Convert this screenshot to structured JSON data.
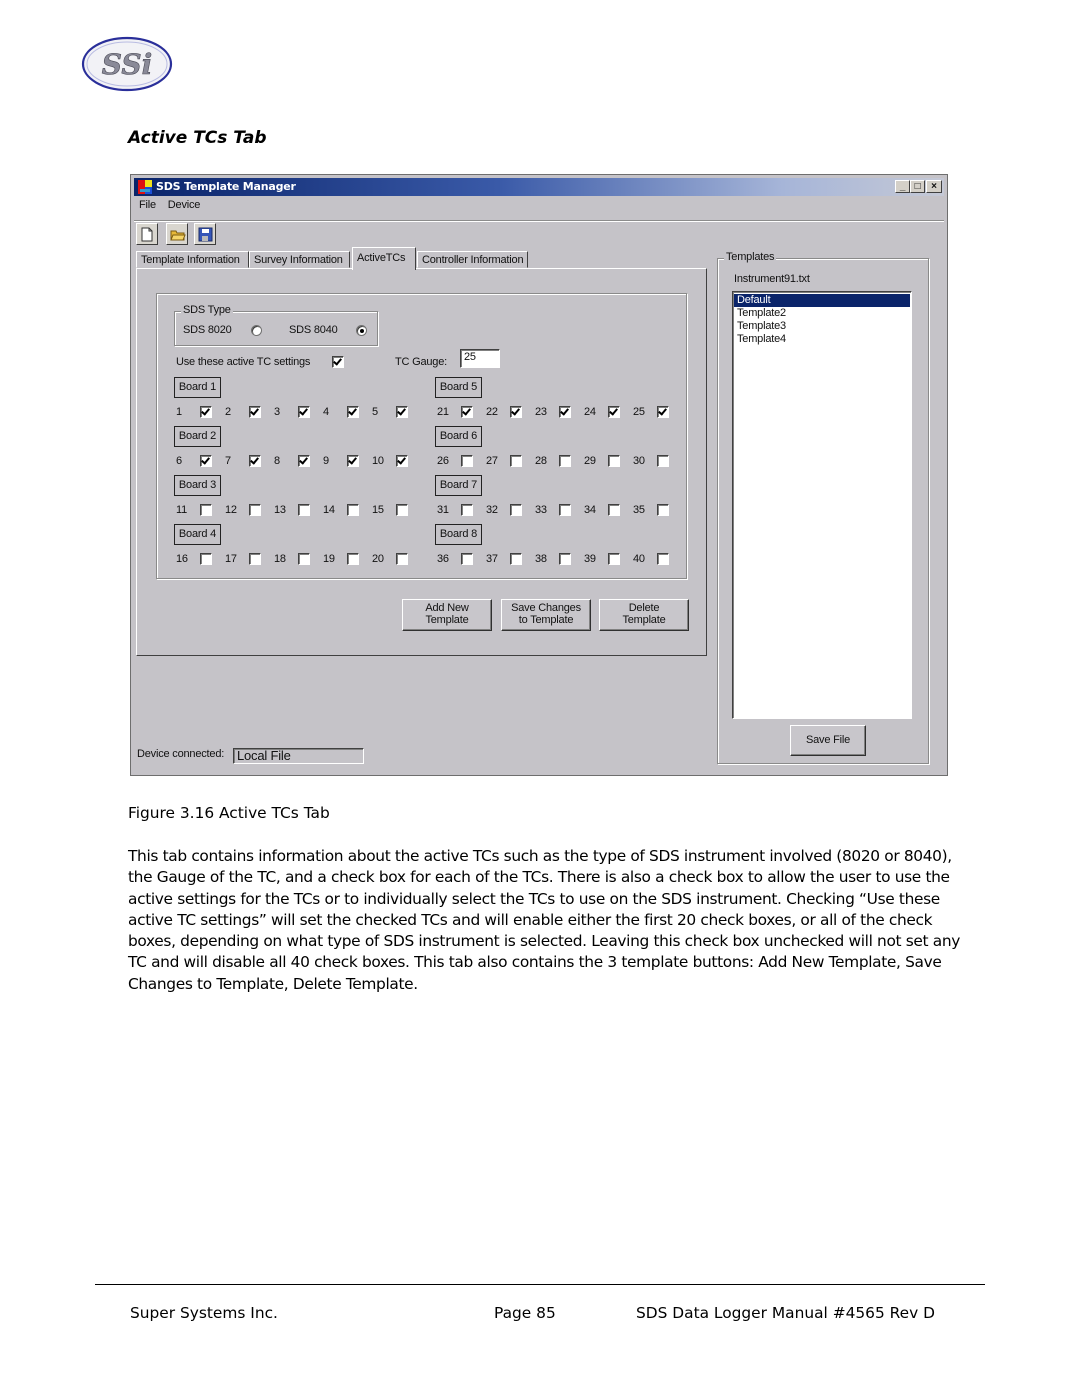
{
  "header": {
    "logo_text": "SSi",
    "section_title": "Active TCs Tab"
  },
  "window": {
    "title": "SDS Template Manager",
    "controls": {
      "minimize": "_",
      "maximize": "□",
      "close": "×"
    },
    "menu": [
      "File",
      "Device"
    ],
    "toolbar": [
      {
        "name": "new-file-icon",
        "tooltip": "New"
      },
      {
        "name": "open-folder-icon",
        "tooltip": "Open"
      },
      {
        "name": "save-disk-icon",
        "tooltip": "Save"
      }
    ],
    "tabs": [
      {
        "label": "Template Information",
        "active": false
      },
      {
        "label": "Survey Information",
        "active": false
      },
      {
        "label": "ActiveTCs",
        "active": true
      },
      {
        "label": "Controller Information",
        "active": false
      }
    ],
    "sds_type": {
      "legend": "SDS Type",
      "options": [
        {
          "label": "SDS 8020",
          "selected": false
        },
        {
          "label": "SDS 8040",
          "selected": true
        }
      ]
    },
    "use_active": {
      "label": "Use these active TC settings",
      "checked": true
    },
    "tc_gauge": {
      "label": "TC Gauge:",
      "value": "25"
    },
    "boards": [
      {
        "label": "Board 1",
        "tcs": [
          {
            "n": "1",
            "checked": true
          },
          {
            "n": "2",
            "checked": true
          },
          {
            "n": "3",
            "checked": true
          },
          {
            "n": "4",
            "checked": true
          },
          {
            "n": "5",
            "checked": true
          }
        ]
      },
      {
        "label": "Board 2",
        "tcs": [
          {
            "n": "6",
            "checked": true
          },
          {
            "n": "7",
            "checked": true
          },
          {
            "n": "8",
            "checked": true
          },
          {
            "n": "9",
            "checked": true
          },
          {
            "n": "10",
            "checked": true
          }
        ]
      },
      {
        "label": "Board 3",
        "tcs": [
          {
            "n": "11",
            "checked": false
          },
          {
            "n": "12",
            "checked": false
          },
          {
            "n": "13",
            "checked": false
          },
          {
            "n": "14",
            "checked": false
          },
          {
            "n": "15",
            "checked": false
          }
        ]
      },
      {
        "label": "Board 4",
        "tcs": [
          {
            "n": "16",
            "checked": false
          },
          {
            "n": "17",
            "checked": false
          },
          {
            "n": "18",
            "checked": false
          },
          {
            "n": "19",
            "checked": false
          },
          {
            "n": "20",
            "checked": false
          }
        ]
      },
      {
        "label": "Board 5",
        "tcs": [
          {
            "n": "21",
            "checked": true
          },
          {
            "n": "22",
            "checked": true
          },
          {
            "n": "23",
            "checked": true
          },
          {
            "n": "24",
            "checked": true
          },
          {
            "n": "25",
            "checked": true
          }
        ]
      },
      {
        "label": "Board 6",
        "tcs": [
          {
            "n": "26",
            "checked": false
          },
          {
            "n": "27",
            "checked": false
          },
          {
            "n": "28",
            "checked": false
          },
          {
            "n": "29",
            "checked": false
          },
          {
            "n": "30",
            "checked": false
          }
        ]
      },
      {
        "label": "Board 7",
        "tcs": [
          {
            "n": "31",
            "checked": false
          },
          {
            "n": "32",
            "checked": false
          },
          {
            "n": "33",
            "checked": false
          },
          {
            "n": "34",
            "checked": false
          },
          {
            "n": "35",
            "checked": false
          }
        ]
      },
      {
        "label": "Board 8",
        "tcs": [
          {
            "n": "36",
            "checked": false
          },
          {
            "n": "37",
            "checked": false
          },
          {
            "n": "38",
            "checked": false
          },
          {
            "n": "39",
            "checked": false
          },
          {
            "n": "40",
            "checked": false
          }
        ]
      }
    ],
    "buttons": {
      "add_new_line1": "Add New",
      "add_new_line2": "Template",
      "save_changes_line1": "Save Changes",
      "save_changes_line2": "to Template",
      "delete_line1": "Delete",
      "delete_line2": "Template"
    },
    "templates": {
      "legend": "Templates",
      "filename": "Instrument91.txt",
      "items": [
        {
          "label": "Default",
          "selected": true
        },
        {
          "label": "Template2",
          "selected": false
        },
        {
          "label": "Template3",
          "selected": false
        },
        {
          "label": "Template4",
          "selected": false
        }
      ],
      "save_file_label": "Save File"
    },
    "status": {
      "label": "Device connected:",
      "value": "Local File"
    }
  },
  "document": {
    "caption": "Figure 3.16 Active TCs Tab",
    "paragraph": "This tab contains information about the active TCs such as the type of SDS instrument involved (8020 or 8040), the Gauge of the TC, and a check box for each of the TCs.  There is also a check box to allow the user to use the active settings for the TCs or to individually select the TCs to use on the SDS instrument.  Checking “Use these active TC settings” will set the checked TCs and will enable either the first 20 check boxes, or all of the check boxes, depending on what type of SDS instrument is selected.  Leaving this check box unchecked will not set any TC and will disable all 40 check boxes.  This tab also contains the 3 template buttons: Add New Template, Save Changes to Template, Delete Template."
  },
  "footer": {
    "company": "Super Systems Inc.",
    "page": "Page 85",
    "manual": "SDS Data Logger Manual #4565 Rev D"
  }
}
